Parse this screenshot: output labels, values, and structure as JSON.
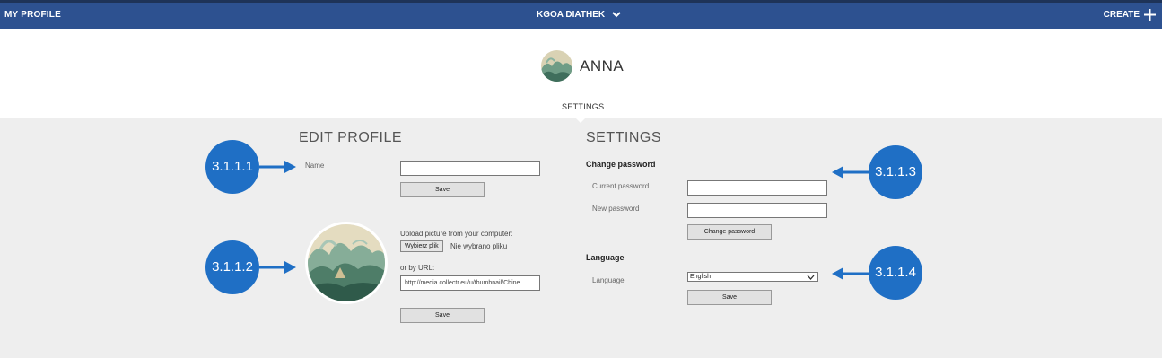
{
  "topbar": {
    "my_profile": "MY PROFILE",
    "workspace": "KGOA DIATHEK",
    "create": "CREATE"
  },
  "profile": {
    "name": "ANNA",
    "tab": "SETTINGS"
  },
  "edit_profile": {
    "title": "EDIT PROFILE",
    "name_label": "Name",
    "name_value": "",
    "save_label": "Save",
    "upload_label": "Upload picture from your computer:",
    "file_button": "Wybierz plik",
    "file_status": "Nie wybrano pliku",
    "url_label": "or by URL:",
    "url_value": "http://media.collectr.eu/u/thumbnail/Chine",
    "save2_label": "Save"
  },
  "settings": {
    "title": "SETTINGS",
    "change_password_heading": "Change password",
    "current_password_label": "Current password",
    "new_password_label": "New password",
    "change_password_button": "Change password",
    "language_heading": "Language",
    "language_label": "Language",
    "language_value": "English",
    "save_label": "Save"
  },
  "annotations": [
    "3.1.1.1",
    "3.1.1.2",
    "3.1.1.3",
    "3.1.1.4"
  ],
  "colors": {
    "topbar": "#2d5190",
    "badge": "#1f6fc5",
    "content_bg": "#eeeeee"
  }
}
